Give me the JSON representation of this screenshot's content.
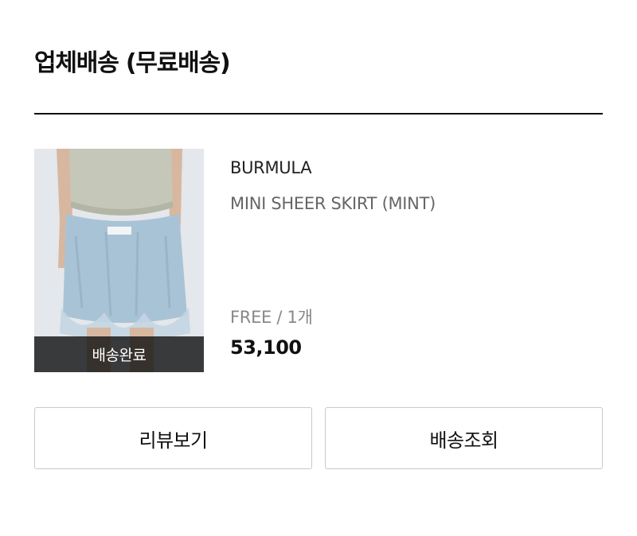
{
  "shipping": {
    "title": "업체배송 (무료배송)"
  },
  "product": {
    "status_label": "배송완료",
    "brand": "BURMULA",
    "name": "MINI SHEER SKIRT (MINT)",
    "option": "FREE / 1개",
    "price": "53,100",
    "image_description_icon": "product-photo"
  },
  "actions": {
    "review_label": "리뷰보기",
    "track_label": "배송조회"
  },
  "colors": {
    "text_primary": "#111111",
    "text_secondary": "#666666",
    "text_muted": "#888888",
    "button_border": "#c9c9c9",
    "overlay": "#141414",
    "skirt": "#a9c3d6"
  }
}
